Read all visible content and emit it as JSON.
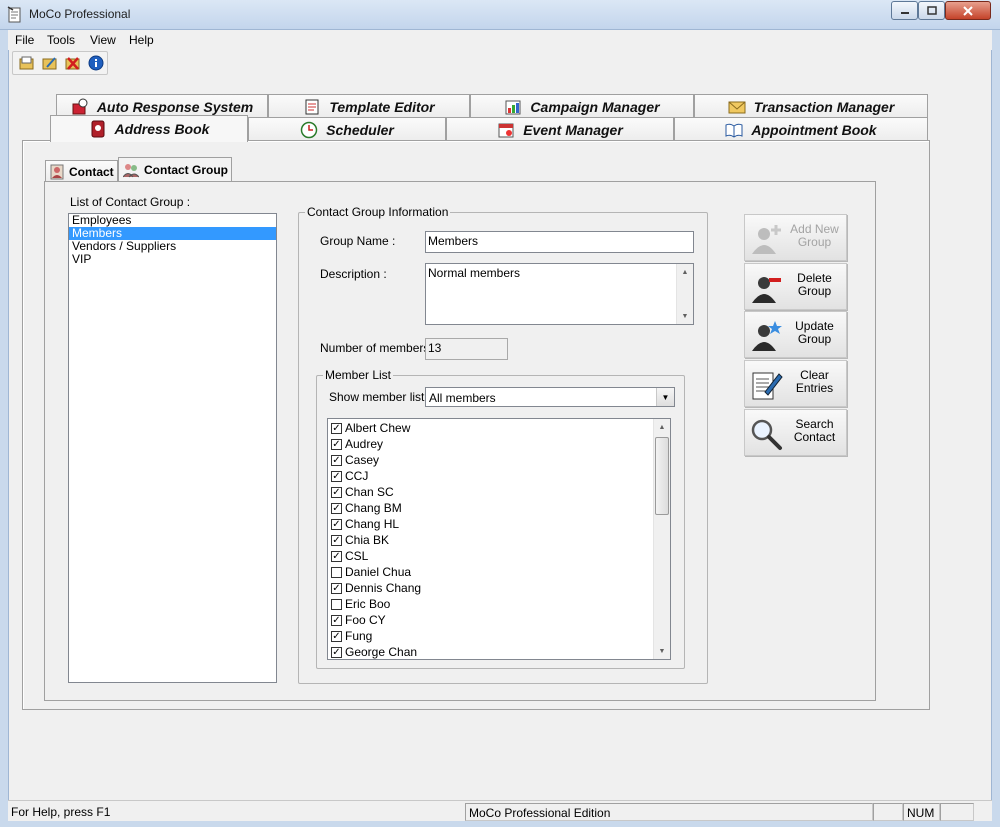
{
  "window": {
    "title": "MoCo Professional"
  },
  "menu": [
    "File",
    "Tools",
    "View",
    "Help"
  ],
  "toolbar": {
    "icons": [
      "open-icon",
      "edit-icon",
      "delete-icon",
      "info-icon"
    ]
  },
  "main_tabs": {
    "row1": [
      "Auto Response System",
      "Template Editor",
      "Campaign Manager",
      "Transaction Manager"
    ],
    "row2": [
      "Address Book",
      "Scheduler",
      "Event Manager",
      "Appointment Book"
    ],
    "active": "Address Book"
  },
  "sub_tabs": {
    "items": [
      "Contact",
      "Contact Group"
    ],
    "active": "Contact Group"
  },
  "group_list": {
    "label": "List of Contact Group :",
    "items": [
      "Employees",
      "Members",
      "Vendors / Suppliers",
      "VIP"
    ],
    "selected": "Members"
  },
  "group_info": {
    "title": "Contact Group Information",
    "name_label": "Group Name :",
    "name_value": "Members",
    "desc_label": "Description :",
    "desc_value": "Normal members",
    "count_label": "Number of members :",
    "count_value": "13"
  },
  "member_list": {
    "title": "Member List",
    "show_label": "Show member list :",
    "show_value": "All members",
    "members": [
      {
        "name": "Albert Chew",
        "checked": true
      },
      {
        "name": "Audrey",
        "checked": true
      },
      {
        "name": "Casey",
        "checked": true
      },
      {
        "name": "CCJ",
        "checked": true
      },
      {
        "name": "Chan SC",
        "checked": true
      },
      {
        "name": "Chang BM",
        "checked": true
      },
      {
        "name": "Chang HL",
        "checked": true
      },
      {
        "name": "Chia BK",
        "checked": true
      },
      {
        "name": "CSL",
        "checked": true
      },
      {
        "name": "Daniel Chua",
        "checked": false
      },
      {
        "name": "Dennis Chang",
        "checked": true
      },
      {
        "name": "Eric Boo",
        "checked": false
      },
      {
        "name": "Foo CY",
        "checked": true
      },
      {
        "name": "Fung",
        "checked": true
      },
      {
        "name": "George Chan",
        "checked": true
      }
    ]
  },
  "actions": {
    "add": {
      "line1": "Add New",
      "line2": "Group",
      "enabled": false
    },
    "delete": {
      "line1": "Delete",
      "line2": "Group",
      "enabled": true
    },
    "update": {
      "line1": "Update",
      "line2": "Group",
      "enabled": true
    },
    "clear": {
      "line1": "Clear",
      "line2": "Entries",
      "enabled": true
    },
    "search": {
      "line1": "Search",
      "line2": "Contact",
      "enabled": true
    }
  },
  "status": {
    "help": "For Help, press F1",
    "edition": "MoCo Professional Edition",
    "num": "NUM"
  }
}
